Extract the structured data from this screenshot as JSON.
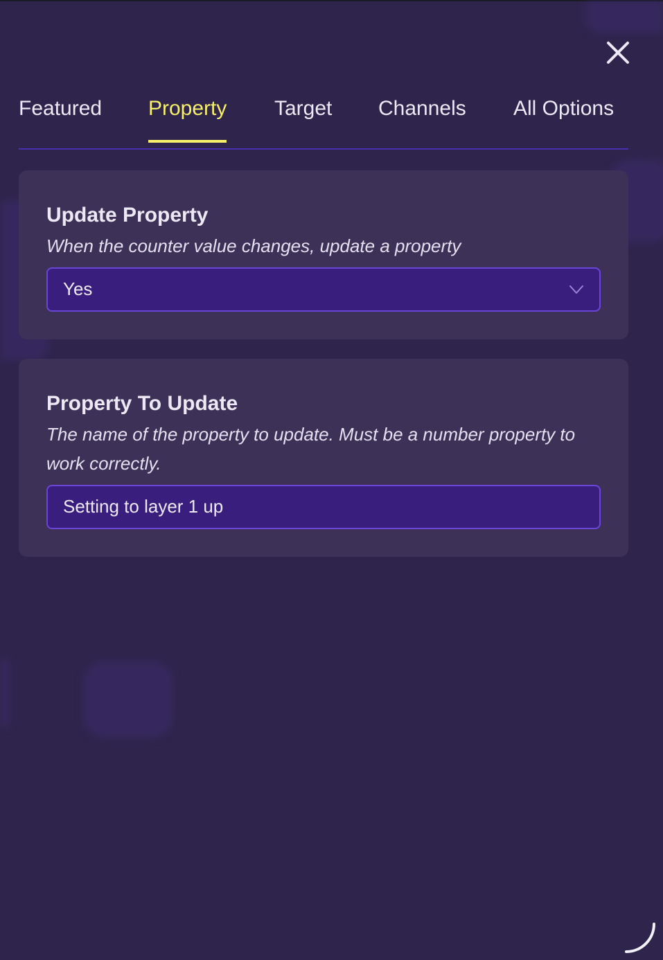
{
  "modal": {
    "close_icon": "close-icon",
    "tabs": [
      {
        "label": "Featured",
        "active": false
      },
      {
        "label": "Property",
        "active": true
      },
      {
        "label": "Target",
        "active": false
      },
      {
        "label": "Channels",
        "active": false
      },
      {
        "label": "All Options",
        "active": false
      }
    ],
    "update_property": {
      "title": "Update Property",
      "description": "When the counter value changes, update a property",
      "selected_value": "Yes"
    },
    "property_to_update": {
      "title": "Property To Update",
      "description": "The name of the property to update. Must be a number property to work correctly.",
      "value": "Setting to layer 1 up"
    }
  },
  "colors": {
    "background": "#2f244c",
    "card": "#3e3158",
    "active_tab": "#f6f06a",
    "field": "#3a1e7e",
    "field_border": "#6a46d8"
  }
}
